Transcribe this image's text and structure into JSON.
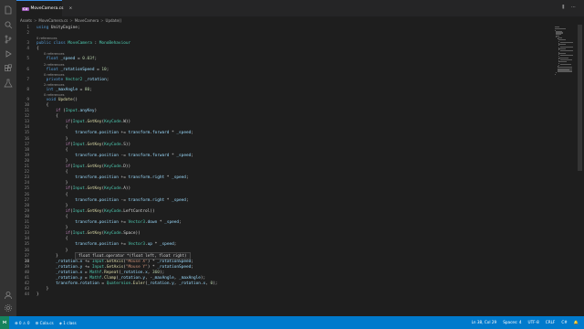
{
  "tabs": {
    "active": {
      "icon": "csharp-icon",
      "badge": "C#",
      "label": "MoveCamera.cs",
      "close": "×"
    },
    "actions_glyphs": "⫼ ⋯"
  },
  "breadcrumb": {
    "items": [
      "Assets",
      "MoveCamera.cs",
      "MoveCamera",
      "Update()"
    ],
    "separator": ">"
  },
  "activity_bar": {
    "icons": [
      "files-icon",
      "search-icon",
      "source-control-icon",
      "run-debug-icon",
      "extensions-icon",
      "test-icon"
    ],
    "bottom_icons": [
      "account-icon",
      "settings-gear-icon"
    ]
  },
  "editor": {
    "active_line": 38,
    "lines": [
      {
        "n": "1",
        "text": "using UnityEngine;"
      },
      {
        "n": "2",
        "text": ""
      },
      {
        "lens": "0 references"
      },
      {
        "n": "3",
        "text": "public class MoveCamera : MonoBehaviour"
      },
      {
        "n": "4",
        "text": "{"
      },
      {
        "lens": "0 references"
      },
      {
        "n": "5",
        "text": "    float _speed = 0.03f;"
      },
      {
        "lens": "2 references"
      },
      {
        "n": "6",
        "text": "    float _rotationSpeed = 10;"
      },
      {
        "lens": "0 references"
      },
      {
        "n": "7",
        "text": "    private Vector2 _rotation;"
      },
      {
        "lens": "2 references"
      },
      {
        "n": "8",
        "text": "    int _maxAngle = 80;"
      },
      {
        "lens": "0 references"
      },
      {
        "n": "9",
        "text": "    void Update()"
      },
      {
        "n": "10",
        "text": "    {"
      },
      {
        "n": "11",
        "text": "        if (Input.anyKey)"
      },
      {
        "n": "12",
        "text": "        {"
      },
      {
        "n": "13",
        "text": "            if(Input.GetKey(KeyCode.W))"
      },
      {
        "n": "14",
        "text": "            {"
      },
      {
        "n": "15",
        "text": "                transform.position += transform.forward * _speed;"
      },
      {
        "n": "16",
        "text": "            }"
      },
      {
        "n": "17",
        "text": "            if(Input.GetKey(KeyCode.S))"
      },
      {
        "n": "18",
        "text": "            {"
      },
      {
        "n": "19",
        "text": "                transform.position -= transform.forward * _speed;"
      },
      {
        "n": "20",
        "text": "            }"
      },
      {
        "n": "21",
        "text": "            if(Input.GetKey(KeyCode.D))"
      },
      {
        "n": "22",
        "text": "            {"
      },
      {
        "n": "23",
        "text": "                transform.position += transform.right * _speed;"
      },
      {
        "n": "24",
        "text": "            }"
      },
      {
        "n": "25",
        "text": "            if(Input.GetKey(KeyCode.A))"
      },
      {
        "n": "26",
        "text": "            {"
      },
      {
        "n": "27",
        "text": "                transform.position -= transform.right * _speed;"
      },
      {
        "n": "28",
        "text": "            }"
      },
      {
        "n": "29",
        "text": "            if(Input.GetKey(KeyCode.LeftControl))"
      },
      {
        "n": "30",
        "text": "            {"
      },
      {
        "n": "31",
        "text": "                transform.position += Vector3.down * _speed;"
      },
      {
        "n": "32",
        "text": "            }"
      },
      {
        "n": "33",
        "text": "            if(Input.GetKey(KeyCode.Space))"
      },
      {
        "n": "34",
        "text": "            {"
      },
      {
        "n": "35",
        "text": "                transform.position += Vector3.up * _speed;"
      },
      {
        "n": "36",
        "text": "            }"
      },
      {
        "n": "37",
        "text": "        }"
      },
      {
        "n": "38",
        "text": "        _rotation.x += Input.GetAxis(\"Mouse X\") * _rotationSpeed;"
      },
      {
        "n": "39",
        "text": "        _rotation.y += Input.GetAxis(\"Mouse Y\") * _rotationSpeed;"
      },
      {
        "n": "40",
        "text": "        _rotation.x = Mathf.Repeat(_rotation.x, 360);"
      },
      {
        "n": "41",
        "text": "        _rotation.y = Mathf.Clamp(_rotation.y, -_maxAngle, _maxAngle);"
      },
      {
        "n": "42",
        "text": "        transform.rotation = Quaternion.Euler(_rotation.y, _rotation.x, 0);"
      },
      {
        "n": "43",
        "text": "    }"
      },
      {
        "n": "44",
        "text": "}"
      }
    ]
  },
  "tooltip": {
    "text": "float float.operator *(float left, float right)"
  },
  "statusbar": {
    "remote_icon": "⋈",
    "left": [
      "⊗ 0 ⚠ 0",
      "⚙ Cola.cs",
      "◈ 1 class"
    ],
    "right": [
      "Ln 38, Col 29",
      "Spaces: 4",
      "UTF-8",
      "CRLF",
      "C#",
      "🔔"
    ]
  },
  "colors": {
    "statusbar": "#007acc",
    "editor_bg": "#1e1e1e",
    "activity_bar": "#333333"
  }
}
